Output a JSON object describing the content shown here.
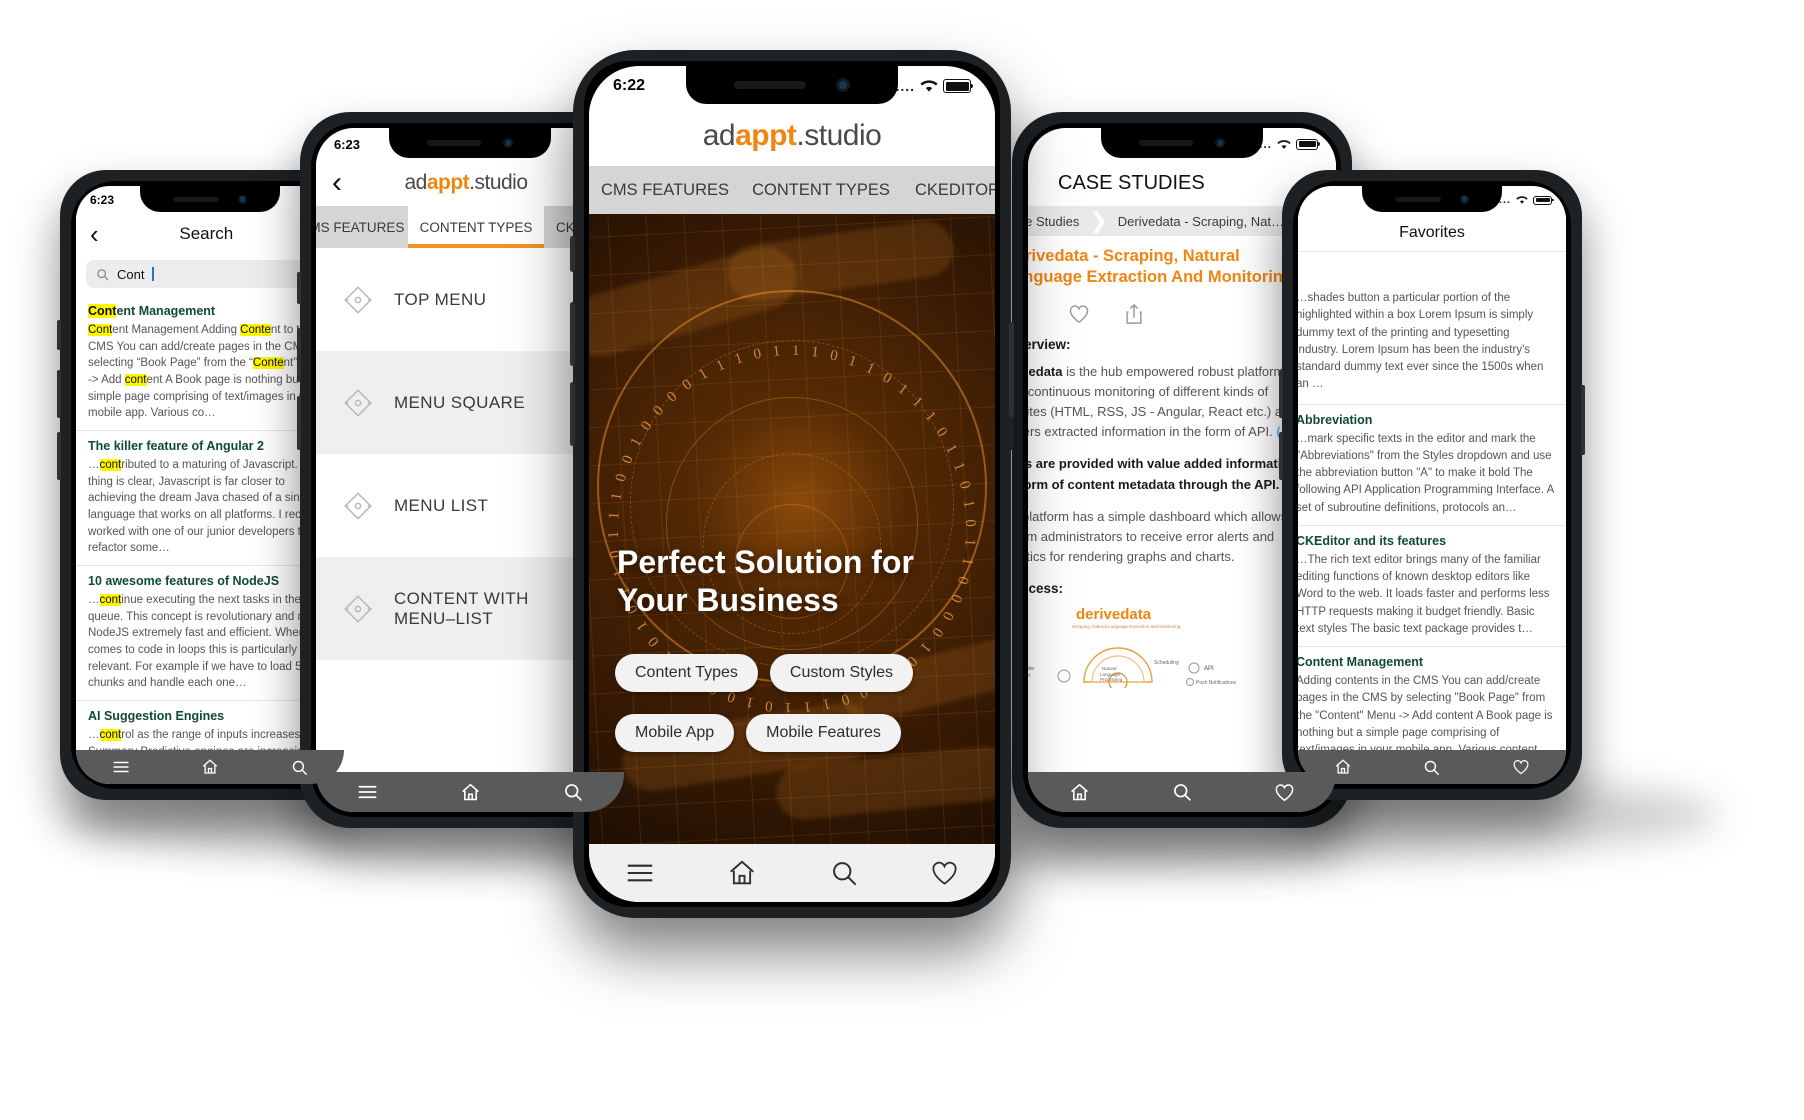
{
  "brand": {
    "accent": "#ef8612",
    "logo_pre": "ad",
    "logo_mid": "appt",
    "logo_post": ".studio",
    "logo_full": "adappt.studio"
  },
  "phones": {
    "search": {
      "name": "search-screen",
      "status": {
        "time": "6:23",
        "signal": "....",
        "wifi": "wifi-icon",
        "battery": "battery-icon"
      },
      "nav": {
        "back": "‹",
        "title": "Search"
      },
      "search_input": {
        "value": "Cont",
        "placeholder": "Search",
        "icon": "search-icon"
      },
      "results": [
        {
          "title_pre": "Cont",
          "title_post": "ent Management",
          "snippet": "Content Management Adding Content to the CMS You can add/create pages in the CMS by selecting “Book Page” from the “Content” Menu -> Add content A Book page is nothing but a simple page comprising of text/images in your mobile app. Various co…"
        },
        {
          "title_pre": "",
          "title_post": "The killer feature of Angular 2",
          "snippet": "…contributed to a maturing of Javascript. One thing is clear, Javascript is far closer to achieving the dream Java chased of a single language that works on all platforms. I recently worked with one of our junior developers to refactor some…"
        },
        {
          "title_pre": "",
          "title_post": "10 awesome features of NodeJS",
          "snippet": "…continue executing the next tasks in the queue. This concept is revolutionary and makes NodeJS extremely fast and efficient. When it comes to code in loops this is particularly relevant. For example if we have to load 50 chunks and handle each one…"
        },
        {
          "title_pre": "",
          "title_post": "AI Suggestion Engines",
          "snippet": "…control as the range of inputs increases. Summary Predictive engines are increasingly giving the giants like Netflixx and Amazon…"
        }
      ],
      "toolbar": [
        "menu-icon",
        "home-icon",
        "search-icon"
      ]
    },
    "content_types": {
      "name": "content-types-screen",
      "status": {
        "time": "6:23"
      },
      "nav": {
        "back": "‹",
        "title": "adappt.studio"
      },
      "tabs": [
        {
          "label": "CMS FEATURES",
          "active": false
        },
        {
          "label": "CONTENT TYPES",
          "active": true
        },
        {
          "label": "CKE",
          "active": false
        }
      ],
      "items": [
        {
          "label": "TOP MENU",
          "icon": "diamond-node-icon"
        },
        {
          "label": "MENU SQUARE",
          "icon": "diamond-node-icon"
        },
        {
          "label": "MENU LIST",
          "icon": "diamond-node-icon"
        },
        {
          "label": "CONTENT WITH MENU–LIST",
          "icon": "diamond-node-icon"
        }
      ],
      "toolbar": [
        "menu-icon",
        "home-icon",
        "search-icon"
      ]
    },
    "home": {
      "name": "home-screen",
      "status": {
        "time": "6:22",
        "signal": "....",
        "wifi": "wifi-icon",
        "battery": "battery-icon"
      },
      "nav": {
        "title": "adappt.studio"
      },
      "tabs": [
        {
          "label": "CMS FEATURES",
          "active": false
        },
        {
          "label": "CONTENT TYPES",
          "active": false
        },
        {
          "label": "CKEDITOR",
          "active": false
        }
      ],
      "hero": {
        "headline_line1": "Perfect Solution for",
        "headline_line2": "Your Business",
        "binary_ring": "1101101110110101100001011001110100011010110111001000011101",
        "pills": [
          "Content Types",
          "Custom Styles",
          "Mobile App",
          "Mobile Features"
        ]
      },
      "toolbar": [
        "menu-icon",
        "home-icon",
        "search-icon",
        "heart-icon"
      ]
    },
    "case_studies": {
      "name": "case-studies-screen",
      "status": {
        "time": "",
        "wifi": "wifi-icon",
        "battery": "battery-icon"
      },
      "nav": {
        "title": "CASE STUDIES"
      },
      "breadcrumb": [
        "Case Studies",
        "Derivedata - Scraping, Nat…"
      ],
      "article_title": "Derivedata - Scraping, Natural Language Extraction And Monitoring",
      "actions": [
        "heart-icon",
        "share-icon"
      ],
      "blocks": [
        {
          "type": "h",
          "text": "Overview:"
        },
        {
          "type": "p",
          "text": "Derivedata is the hub empowered robust platform which does continuous monitoring of different kinds of websites (HTML, RSS, JS - Angular, React etc.) and delivers extracted information in the form of API. (1)"
        },
        {
          "type": "b",
          "text": "Users are provided with value added information in the form of content metadata through the API."
        },
        {
          "type": "p",
          "text": "The platform has a simple dashboard which allows system administrators to receive error alerts and statistics for rendering graphs and charts."
        },
        {
          "type": "h",
          "text": "Process:"
        }
      ],
      "image_caption": "derivedata",
      "image_labels": [
        "API",
        "Scheduling",
        "Natural Language Processing",
        "Push Notifications",
        "ular er"
      ],
      "toolbar": [
        "home-icon",
        "search-icon",
        "heart-icon"
      ]
    },
    "favorites": {
      "name": "favorites-screen",
      "status": {
        "wifi": "wifi-icon",
        "battery": "battery-icon"
      },
      "nav": {
        "title": "Favorites"
      },
      "items": [
        {
          "title": "",
          "snippet": "…shades button a particular portion of the highlighted within a box Lorem Ipsum is simply dummy text of the printing and typesetting industry. Lorem Ipsum has been the industry's standard dummy text ever since the 1500s when an …"
        },
        {
          "title": "Abbreviation",
          "snippet": "…mark specific texts in the editor and mark the \"Abbreviations\" from the Styles dropdown and use the abbreviation button \"A\" to make it bold The following API Application Programming Interface. A set of subroutine definitions, protocols an…"
        },
        {
          "title": "CKEditor and its features",
          "snippet": "…The rich text editor brings many of the familiar editing functions of known desktop editors like Word to the web. It loads faster and performs less HTTP requests making it budget friendly. Basic text styles The basic text package provides t…"
        },
        {
          "title": "Content Management",
          "snippet": "Adding contents in the CMS You can add/create pages in the CMS by selecting \"Book Page\" from the \"Content\" Menu -> Add content A Book page is nothing but a simple page comprising of text/images in your mobile app. Various content…"
        }
      ],
      "toolbar": [
        "home-icon",
        "search-icon",
        "heart-icon"
      ]
    }
  }
}
